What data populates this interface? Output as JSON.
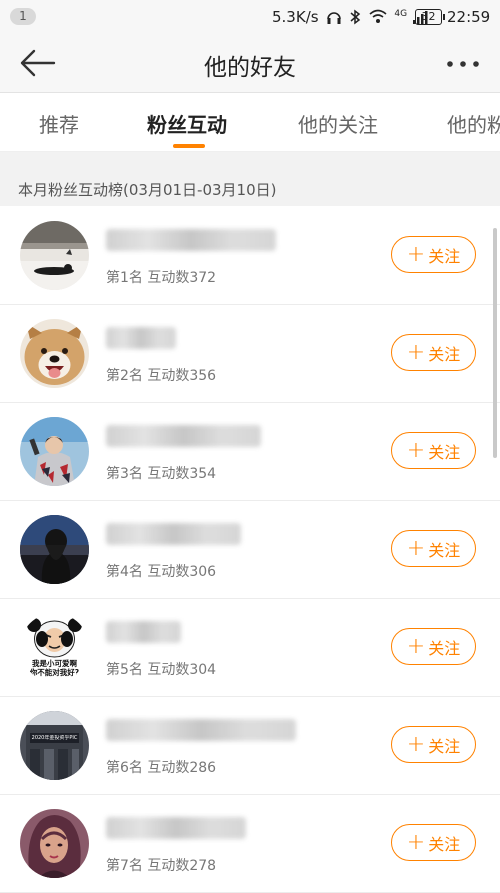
{
  "status_bar": {
    "notification_count": "1",
    "net_speed": "5.3K/s",
    "network": "4G",
    "battery": "32",
    "time": "22:59"
  },
  "nav": {
    "title": "他的好友",
    "back_icon": "arrow-left-icon",
    "more_icon": "more-dots-icon"
  },
  "tabs": [
    {
      "label": "推荐"
    },
    {
      "label": "粉丝互动"
    },
    {
      "label": "他的关注"
    },
    {
      "label": "他的粉"
    }
  ],
  "active_tab": "粉丝互动",
  "section": {
    "header": "本月粉丝互动榜(03月01日-03月10日)"
  },
  "follow_label": "关注",
  "accent_color": "#ff8200",
  "fans": [
    {
      "rank_text": "第1名 互动数372",
      "avatar": "dog-lying-photo"
    },
    {
      "rank_text": "第2名 互动数356",
      "avatar": "shiba-dog-photo"
    },
    {
      "rank_text": "第3名 互动数354",
      "avatar": "singer-photo"
    },
    {
      "rank_text": "第4名 互动数306",
      "avatar": "girl-back-photo"
    },
    {
      "rank_text": "第5名 互动数304",
      "avatar": "panda-meme"
    },
    {
      "rank_text": "第6名 互动数286",
      "avatar": "building-photo"
    },
    {
      "rank_text": "第7名 互动数278",
      "avatar": "illustrated-woman"
    }
  ],
  "panda_meme_text": [
    "我是小可爱啊",
    "你不能对我好?"
  ],
  "building_sign_text": "2020年金投资乎PIC"
}
